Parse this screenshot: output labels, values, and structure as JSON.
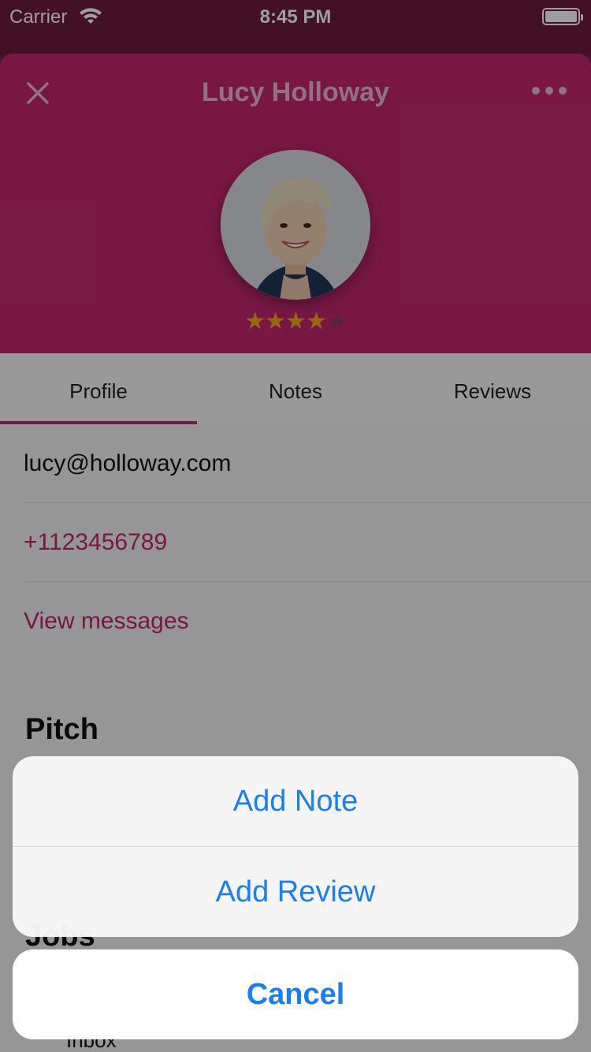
{
  "status_bar": {
    "carrier": "Carrier",
    "time": "8:45 PM"
  },
  "header": {
    "name": "Lucy Holloway",
    "rating": 4,
    "rating_max": 5
  },
  "tabs": [
    {
      "label": "Profile",
      "active": true
    },
    {
      "label": "Notes",
      "active": false
    },
    {
      "label": "Reviews",
      "active": false
    }
  ],
  "contact": {
    "email": "lucy@holloway.com",
    "phone": "+1123456789",
    "messages_link": "View messages"
  },
  "sections": {
    "pitch": "Pitch",
    "jobs": "Jobs",
    "inbox": "Inbox"
  },
  "action_sheet": {
    "actions": [
      "Add Note",
      "Add Review"
    ],
    "cancel": "Cancel"
  },
  "colors": {
    "accent": "#c2266f",
    "action_blue": "#1a7ef5",
    "star": "#f0a81a"
  }
}
